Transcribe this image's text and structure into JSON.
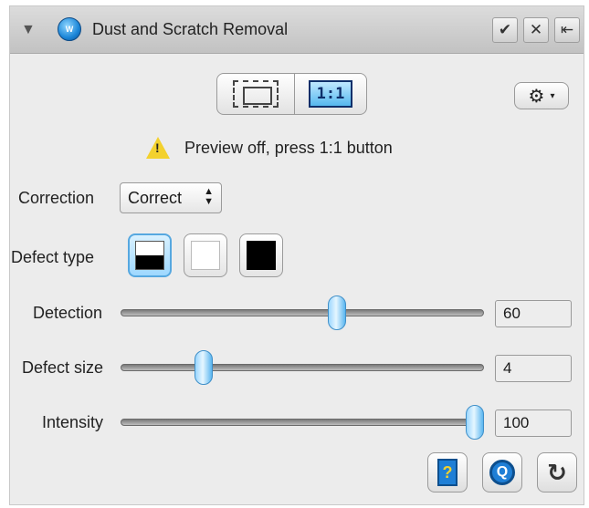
{
  "titlebar": {
    "title": "Dust and Scratch Removal",
    "plugin_icon_text": "W",
    "disclosure_icon": "▼",
    "apply_icon": "✔",
    "close_icon": "✕",
    "detach_icon": "⇤"
  },
  "preview": {
    "fit_mode": "fit-to-window",
    "one_to_one_label": "1:1",
    "gear_icon": "⚙",
    "gear_caret": "▾"
  },
  "warning": {
    "icon": "!",
    "text": "Preview off, press 1:1 button"
  },
  "correction": {
    "label": "Correction",
    "value": "Correct",
    "arrows": "▲\n▼"
  },
  "defect_type": {
    "label": "Defect type",
    "options": [
      "half-white-half-black",
      "white",
      "black"
    ],
    "selected_index": 0
  },
  "sliders": {
    "detection": {
      "label": "Detection",
      "value": "60",
      "min": 0,
      "max": 100
    },
    "defect_size": {
      "label": "Defect size",
      "value": "4",
      "min": 1,
      "max": 15
    },
    "intensity": {
      "label": "Intensity",
      "value": "100",
      "min": 0,
      "max": 100
    }
  },
  "footer": {
    "help_icon": "?",
    "search_icon": "Q",
    "reset_icon": "↻"
  },
  "colors": {
    "accent": "#1f7fd6",
    "warning": "#f3d12e",
    "selected_bg": "#9ed8ff"
  }
}
